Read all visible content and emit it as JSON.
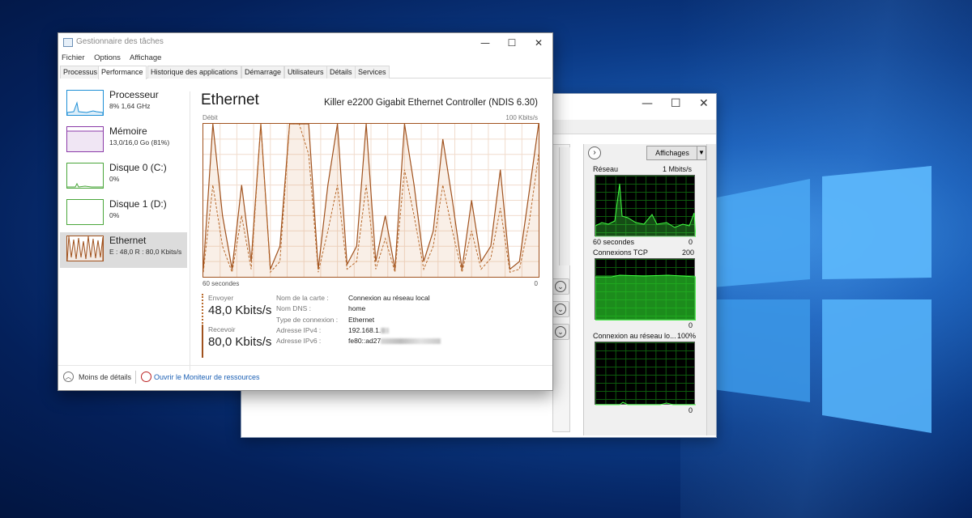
{
  "task_manager": {
    "title": "Gestionnaire des tâches",
    "menu": [
      "Fichier",
      "Options",
      "Affichage"
    ],
    "tabs": [
      "Processus",
      "Performance",
      "Historique des applications",
      "Démarrage",
      "Utilisateurs",
      "Détails",
      "Services"
    ],
    "active_tab": "Performance",
    "sidebar": [
      {
        "name": "Processeur",
        "sub": "8% 1,64 GHz",
        "color": "#1e8fd6"
      },
      {
        "name": "Mémoire",
        "sub": "13,0/16,0 Go (81%)",
        "color": "#8b3aa8"
      },
      {
        "name": "Disque 0 (C:)",
        "sub": "0%",
        "color": "#4aa63a"
      },
      {
        "name": "Disque 1 (D:)",
        "sub": "0%",
        "color": "#4aa63a"
      },
      {
        "name": "Ethernet",
        "sub": "E : 48,0 R : 80,0 Kbits/s",
        "color": "#a0521e"
      }
    ],
    "main": {
      "heading": "Ethernet",
      "adapter": "Killer e2200 Gigabit Ethernet Controller (NDIS 6.30)",
      "axis_label": "Débit",
      "axis_max": "100 Kbits/s",
      "axis_time": "60 secondes",
      "axis_min": "0"
    },
    "send": {
      "label": "Envoyer",
      "value": "48,0 Kbits/s"
    },
    "receive": {
      "label": "Recevoir",
      "value": "80,0 Kbits/s"
    },
    "details": [
      {
        "key": "Nom de la carte :",
        "value": "Connexion au réseau local"
      },
      {
        "key": "Nom DNS :",
        "value": "home"
      },
      {
        "key": "Type de connexion :",
        "value": "Ethernet"
      },
      {
        "key": "Adresse IPv4 :",
        "value": "192.168.1."
      },
      {
        "key": "Adresse IPv6 :",
        "value": "fe80::ad27"
      }
    ],
    "footer": {
      "less_details": "Moins de détails",
      "open_monitor": "Ouvrir le Moniteur de ressources"
    }
  },
  "resource_monitor": {
    "view_button": "Affichages",
    "graphs": [
      {
        "title": "Réseau",
        "max": "1 Mbits/s",
        "left": "60 secondes",
        "right": "0"
      },
      {
        "title": "Connexions TCP",
        "max": "200",
        "left": "",
        "right": "0"
      },
      {
        "title": "Connexion au réseau lo...",
        "max": "100%",
        "left": "",
        "right": "0"
      }
    ]
  },
  "chart_data": {
    "type": "line",
    "ylabel": "Débit",
    "ylim": [
      0,
      100
    ],
    "x_range": "60 secondes",
    "units": "Kbits/s",
    "series": [
      {
        "name": "Recevoir",
        "values": [
          5,
          100,
          40,
          5,
          60,
          10,
          100,
          5,
          20,
          100,
          100,
          100,
          5,
          60,
          100,
          8,
          20,
          100,
          10,
          40,
          5,
          100,
          60,
          10,
          30,
          90,
          50,
          5,
          50,
          10,
          20,
          70,
          5,
          10,
          55,
          100
        ]
      },
      {
        "name": "Envoyer",
        "values": [
          3,
          60,
          20,
          3,
          40,
          5,
          100,
          3,
          10,
          100,
          100,
          80,
          3,
          30,
          60,
          5,
          10,
          60,
          5,
          25,
          3,
          70,
          40,
          5,
          20,
          60,
          30,
          3,
          30,
          5,
          12,
          45,
          3,
          5,
          35,
          80
        ]
      }
    ]
  }
}
